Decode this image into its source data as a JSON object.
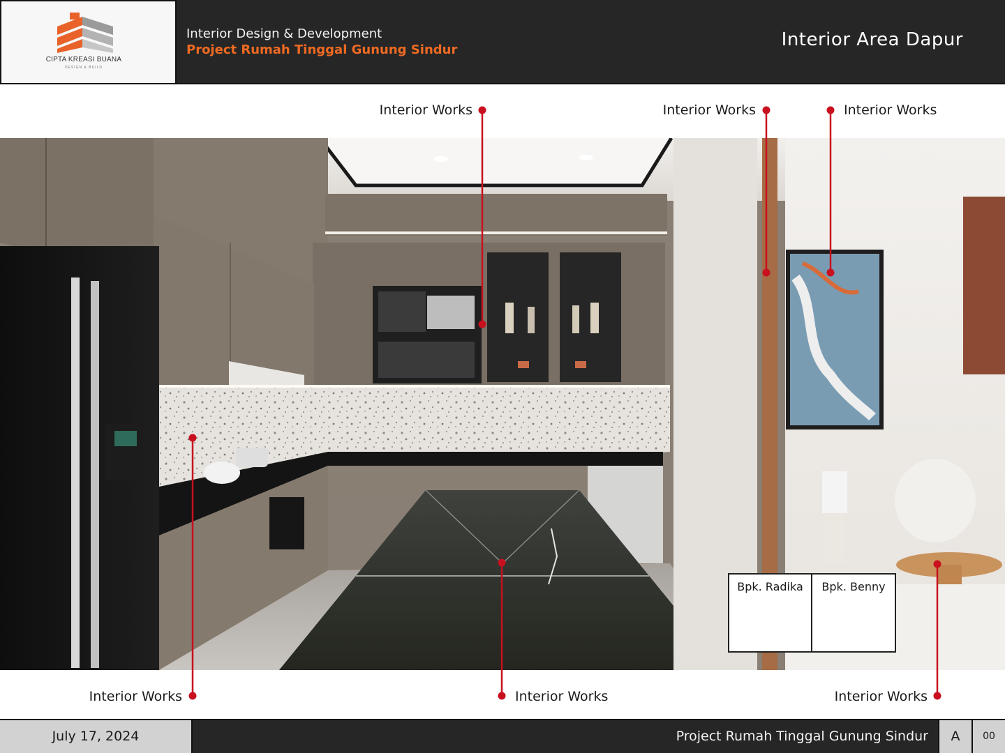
{
  "header": {
    "company_name": "CIPTA KREASI BUANA",
    "company_tagline": "DESIGN & BUILD",
    "subtitle": "Interior Design & Development",
    "project": "Project Rumah Tinggal Gunung Sindur",
    "sheet_title": "Interior Area Dapur",
    "accent_color": "#ee6a22"
  },
  "callouts": {
    "top": [
      {
        "label": "Interior Works"
      },
      {
        "label": "Interior Works"
      },
      {
        "label": "Interior Works"
      }
    ],
    "bottom": [
      {
        "label": "Interior Works"
      },
      {
        "label": "Interior Works"
      },
      {
        "label": "Interior Works"
      }
    ],
    "marker_color": "#c8101e"
  },
  "clients": [
    {
      "name": "Bpk. Radika"
    },
    {
      "name": "Bpk. Benny"
    }
  ],
  "footer": {
    "date": "July 17, 2024",
    "project": "Project Rumah Tinggal Gunung Sindur",
    "revision": "A",
    "sheet_number": "00"
  }
}
